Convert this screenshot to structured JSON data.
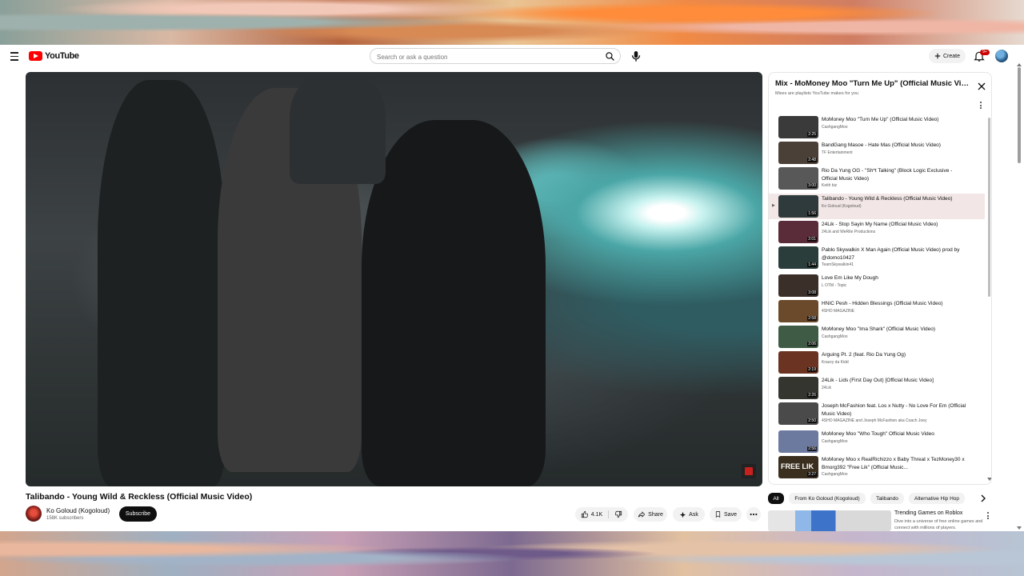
{
  "header": {
    "logo_text": "YouTube",
    "search_placeholder": "Search or ask a question",
    "create_label": "Create",
    "notification_badge": "9+"
  },
  "video": {
    "title": "Talibando - Young Wild & Reckless (Official Music Video)",
    "channel": "Ko Goloud (Kogoloud)",
    "subscribers": "158K subscribers",
    "subscribe_label": "Subscribe",
    "likes": "4.1K",
    "share_label": "Share",
    "ask_label": "Ask",
    "save_label": "Save"
  },
  "playlist": {
    "title": "Mix - MoMoney Moo \"Turn Me Up\" (Official Music Video)",
    "subtitle": "Mixes are playlists YouTube makes for you",
    "items": [
      {
        "title": "MoMoney Moo \"Turn Me Up\" (Official Music Video)",
        "channel": "CashgangMoo",
        "duration": "2:25",
        "active": false,
        "thumb": "#3a3a3a"
      },
      {
        "title": "BandGang Masoe - Hate Mas (Official Music Video)",
        "channel": "TF Entertainment",
        "duration": "2:48",
        "active": false,
        "thumb": "#4b4038"
      },
      {
        "title": "Rio Da Yung OG - \"Sh*t Talking\" (Block Logic Exclusive - Official Music Video)",
        "channel": "Keith biz",
        "duration": "3:00",
        "active": false,
        "thumb": "#585858"
      },
      {
        "title": "Talibando - Young Wild & Reckless (Official Music Video)",
        "channel": "Ko Goloud (Kogoloud)",
        "duration": "1:56",
        "active": true,
        "thumb": "#2e3a3b"
      },
      {
        "title": "24Lik - Stop Sayin My Name (Official Music Video)",
        "channel": "24Lik and WeRite Productions",
        "duration": "2:01",
        "active": false,
        "thumb": "#5a2b38"
      },
      {
        "title": "Pablo Skywalkin X Man Again (Official Music Video) prod by @domo10427",
        "channel": "TeamSkywalkin41",
        "duration": "1:44",
        "active": false,
        "thumb": "#2a3d3b"
      },
      {
        "title": "Love Em Like My Dough",
        "channel": "L OTM - Topic",
        "duration": "3:08",
        "active": false,
        "thumb": "#3b2f2a"
      },
      {
        "title": "HNIC Pesh - Hidden Blessings (Official Music Video)",
        "channel": "4SHO MAGAZINE",
        "duration": "2:58",
        "active": false,
        "thumb": "#6b4a2c"
      },
      {
        "title": "MoMoney Moo \"Ima Shark\" (Official Music Video)",
        "channel": "CashgangMoo",
        "duration": "2:06",
        "active": false,
        "thumb": "#3f5b45"
      },
      {
        "title": "Arguing Pt. 2 (feat. Rio Da Yung Og)",
        "channel": "Krazzy da Kidd",
        "duration": "2:19",
        "active": false,
        "thumb": "#6a3322"
      },
      {
        "title": "24Lik - Lids (First Day Out) [Official Music Video]",
        "channel": "24Lik",
        "duration": "2:26",
        "active": false,
        "thumb": "#35352f"
      },
      {
        "title": "Joseph McFashion feat. Los x Nutty - No Love For Em (Official Music Video)",
        "channel": "4SHO MAGAZINE and Joseph McFashion aka Coach Joey",
        "duration": "2:50",
        "active": false,
        "thumb": "#4a4a4a"
      },
      {
        "title": "MoMoney Moo \"Who Tough\" Official Music Video",
        "channel": "CashgangMoo",
        "duration": "2:56",
        "active": false,
        "thumb": "#6d7aa0"
      },
      {
        "title": "MoMoney Moo x RealRichizzo x Baby Threat x TezMoney30 x Bmorg392 \"Free Lik\" (Official Music...",
        "channel": "CashgangMoo",
        "duration": "2:27",
        "active": false,
        "thumb": "#3a2f1e",
        "thumb_text": "FREE LIK"
      }
    ]
  },
  "chips": [
    "All",
    "From Ko Goloud (Kogoloud)",
    "Talibando",
    "Alternative Hip Hop"
  ],
  "ad": {
    "title": "Trending Games on Roblox",
    "description": "Dive into a universe of free online games and connect with millions of players."
  },
  "colors": {
    "brand_red": "#ff0000",
    "active_row": "#f2e6e6",
    "dark_button": "#0f0f0f"
  }
}
